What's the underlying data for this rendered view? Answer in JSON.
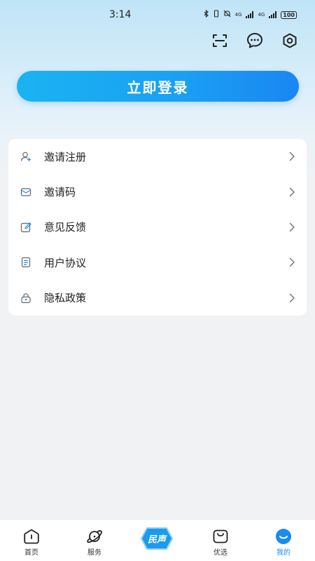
{
  "status_bar": {
    "time": "3:14",
    "network1": "4G",
    "network2": "4G",
    "battery": "100"
  },
  "login_button": "立即登录",
  "menu": [
    {
      "label": "邀请注册",
      "icon": "user-add-icon"
    },
    {
      "label": "邀请码",
      "icon": "envelope-icon"
    },
    {
      "label": "意见反馈",
      "icon": "edit-icon"
    },
    {
      "label": "用户协议",
      "icon": "document-icon"
    },
    {
      "label": "隐私政策",
      "icon": "lock-icon"
    }
  ],
  "tabs": {
    "home": "首页",
    "service": "服务",
    "center": "民声",
    "mall": "优选",
    "mine": "我的"
  },
  "colors": {
    "accent": "#1a8cf0",
    "login_gradient_start": "#1bb3f2",
    "login_gradient_end": "#1a86f2"
  }
}
